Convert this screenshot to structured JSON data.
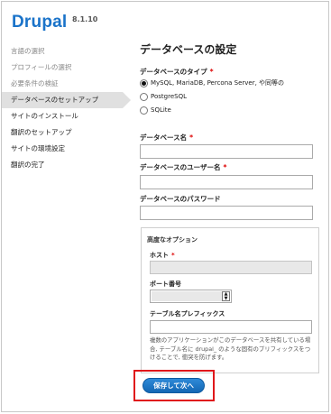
{
  "app": {
    "name": "Drupal",
    "version": "8.1.10"
  },
  "steps": [
    {
      "label": "言語の選択",
      "state": "done"
    },
    {
      "label": "プロフィールの選択",
      "state": "done"
    },
    {
      "label": "必要条件の検証",
      "state": "done"
    },
    {
      "label": "データベースのセットアップ",
      "state": "active"
    },
    {
      "label": "サイトのインストール",
      "state": "pending"
    },
    {
      "label": "翻訳のセットアップ",
      "state": "pending"
    },
    {
      "label": "サイトの環境設定",
      "state": "pending"
    },
    {
      "label": "翻訳の完了",
      "state": "pending"
    }
  ],
  "form": {
    "title": "データベースの設定",
    "db_type": {
      "label": "データベースのタイプ",
      "required_mark": "*",
      "options": [
        {
          "label": "MySQL, MariaDB, Percona Server, や同等の",
          "checked": true
        },
        {
          "label": "PostgreSQL",
          "checked": false
        },
        {
          "label": "SQLite",
          "checked": false
        }
      ]
    },
    "db_name": {
      "label": "データベース名",
      "required_mark": "*",
      "value": ""
    },
    "db_user": {
      "label": "データベースのユーザー名",
      "required_mark": "*",
      "value": ""
    },
    "db_password": {
      "label": "データベースのパスワード",
      "value": ""
    },
    "advanced": {
      "legend": "高度なオプション",
      "host": {
        "label": "ホスト",
        "required_mark": "*"
      },
      "port": {
        "label": "ポート番号"
      },
      "prefix": {
        "label": "テーブル名プレフィックス",
        "description": "複数のアプリケーションがこのデータベースを共有している場合, テーブル名に drupal_ のような固有のプリフィックスをつけることで, 衝突を防げます。"
      }
    },
    "submit_label": "保存して次へ"
  },
  "colors": {
    "brand": "#1a73c9",
    "button": "#1b76c6",
    "highlight": "#e0171b"
  }
}
